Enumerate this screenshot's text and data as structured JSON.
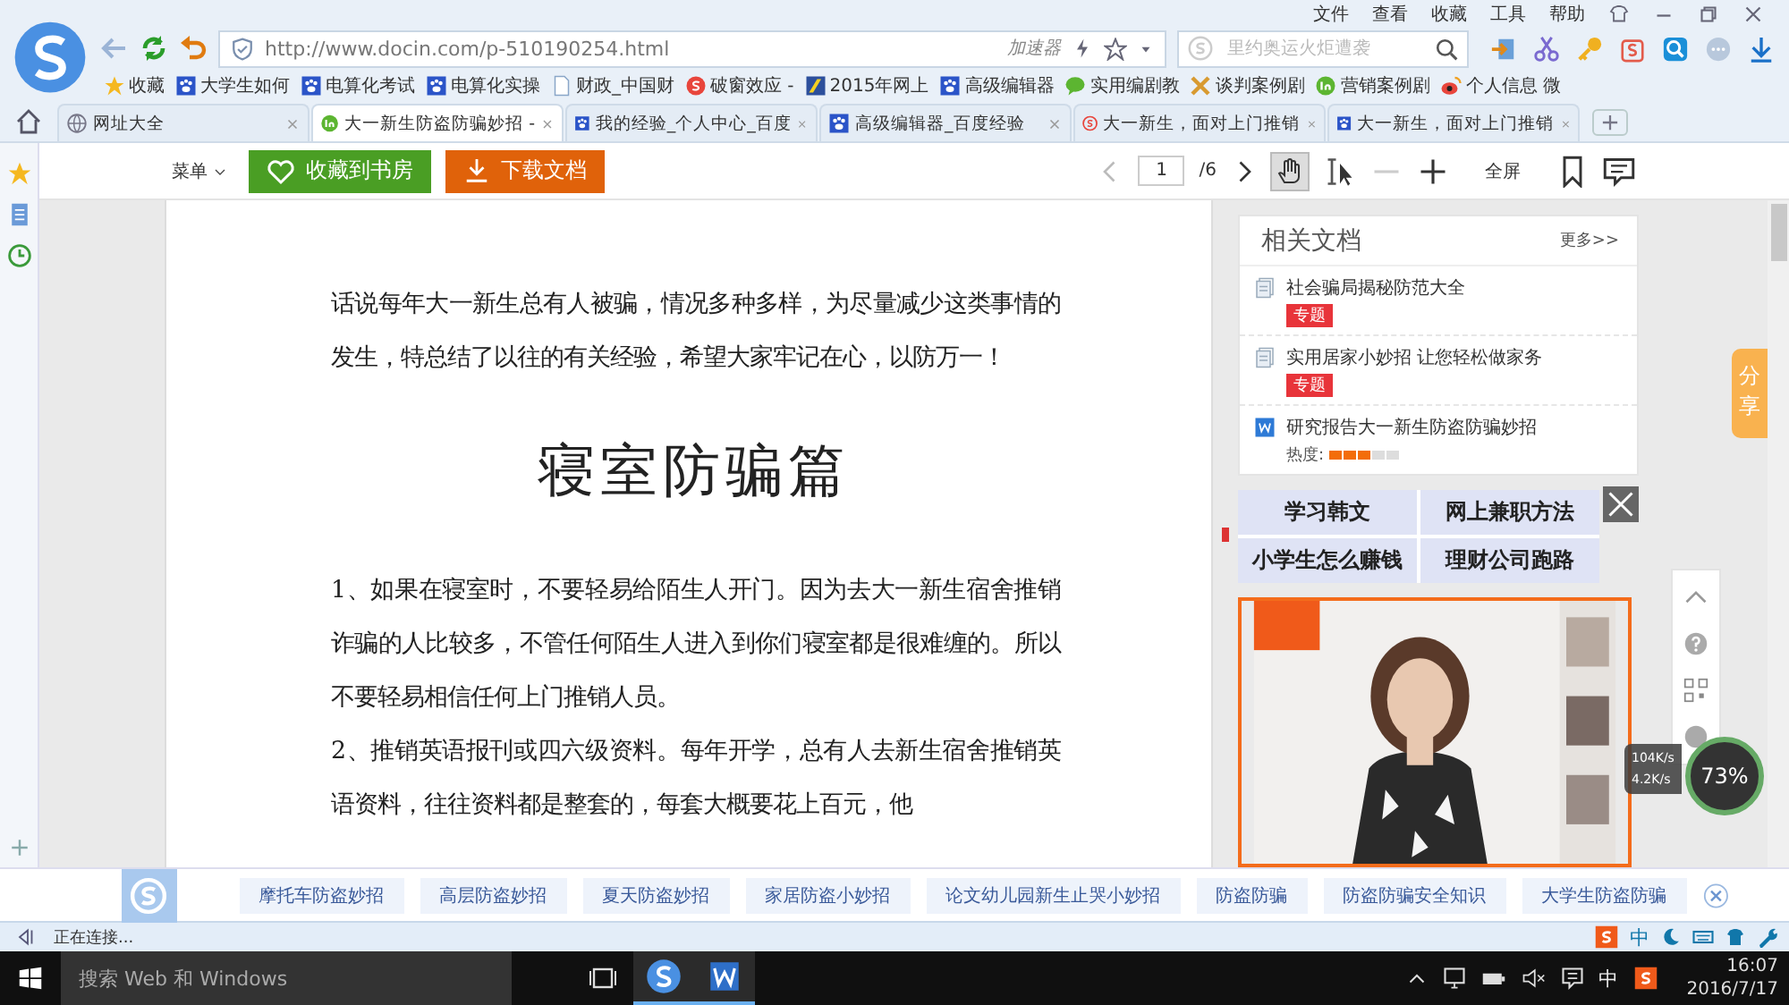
{
  "browser": {
    "menu": [
      "文件",
      "查看",
      "收藏",
      "工具",
      "帮助"
    ],
    "address": {
      "url": "http://www.docin.com/p-510190254.html",
      "accelerator": "加速器"
    },
    "search": {
      "placeholder": "里约奥运火炬遭袭"
    },
    "bookmarks": [
      "收藏",
      "大学生如何",
      "电算化考试",
      "电算化实操",
      "财政_中国财",
      "破窗效应 -",
      "2015年网上",
      "高级编辑器",
      "实用编剧教",
      "谈判案例剧",
      "营销案例剧",
      "个人信息 微"
    ],
    "tabs": [
      {
        "label": "网址大全",
        "selected": false
      },
      {
        "label": "大一新生防盗防骗妙招 -",
        "selected": true
      },
      {
        "label": "我的经验_个人中心_百度",
        "selected": false
      },
      {
        "label": "高级编辑器_百度经验",
        "selected": false
      },
      {
        "label": "大一新生，面对上门推销",
        "selected": false
      },
      {
        "label": "大一新生，面对上门推销",
        "selected": false
      }
    ]
  },
  "viewer": {
    "menu": "菜单",
    "collect_button": "收藏到书房",
    "download_button": "下载文档",
    "page": "1",
    "page_total": "/6",
    "fullscreen": "全屏"
  },
  "document": {
    "paragraphs": [
      {
        "kind": "text",
        "text": "话说每年大一新生总有人被骗，情况多种多样，为尽量减少这类事情的发生，特总结了以往的有关经验，希望大家牢记在心，以防万一！"
      },
      {
        "kind": "heading",
        "text": "寝室防骗篇"
      },
      {
        "kind": "text",
        "text": "1、如果在寝室时，不要轻易给陌生人开门。因为去大一新生宿舍推销诈骗的人比较多，不管任何陌生人进入到你们寝室都是很难缠的。所以不要轻易相信任何上门推销人员。"
      },
      {
        "kind": "text",
        "text": "2、推销英语报刊或四六级资料。每年开学，总有人去新生宿舍推销英语资料，往往资料都是整套的，每套大概要花上百元，他"
      }
    ]
  },
  "related": {
    "title": "相关文档",
    "more": "更多>>",
    "items": [
      {
        "kind": "topic",
        "title": "社会骗局揭秘防范大全",
        "badge": "专题"
      },
      {
        "kind": "topic",
        "title": "实用居家小妙招 让您轻松做家务",
        "badge": "专题"
      },
      {
        "kind": "heat",
        "title": "研究报告大一新生防盗防骗妙招",
        "heat_label": "热度:",
        "level": 0.6
      }
    ]
  },
  "ads": {
    "links": [
      "学习韩文",
      "网上兼职方法",
      "小学生怎么赚钱",
      "理财公司跑路"
    ]
  },
  "share": "分享",
  "speed": {
    "up": "104K/s",
    "down": "4.2K/s",
    "usage": "73%"
  },
  "bottom_tags": [
    "摩托车防盗妙招",
    "高层防盗妙招",
    "夏天防盗妙招",
    "家居防盗小妙招",
    "论文幼儿园新生止哭小妙招",
    "防盗防骗",
    "防盗防骗安全知识",
    "大学生防盗防骗"
  ],
  "status": "正在连接...",
  "status_ime": "中",
  "taskbar": {
    "search_placeholder": "搜索 Web 和 Windows",
    "ime": "中",
    "time": "16:07",
    "date": "2016/7/17"
  }
}
